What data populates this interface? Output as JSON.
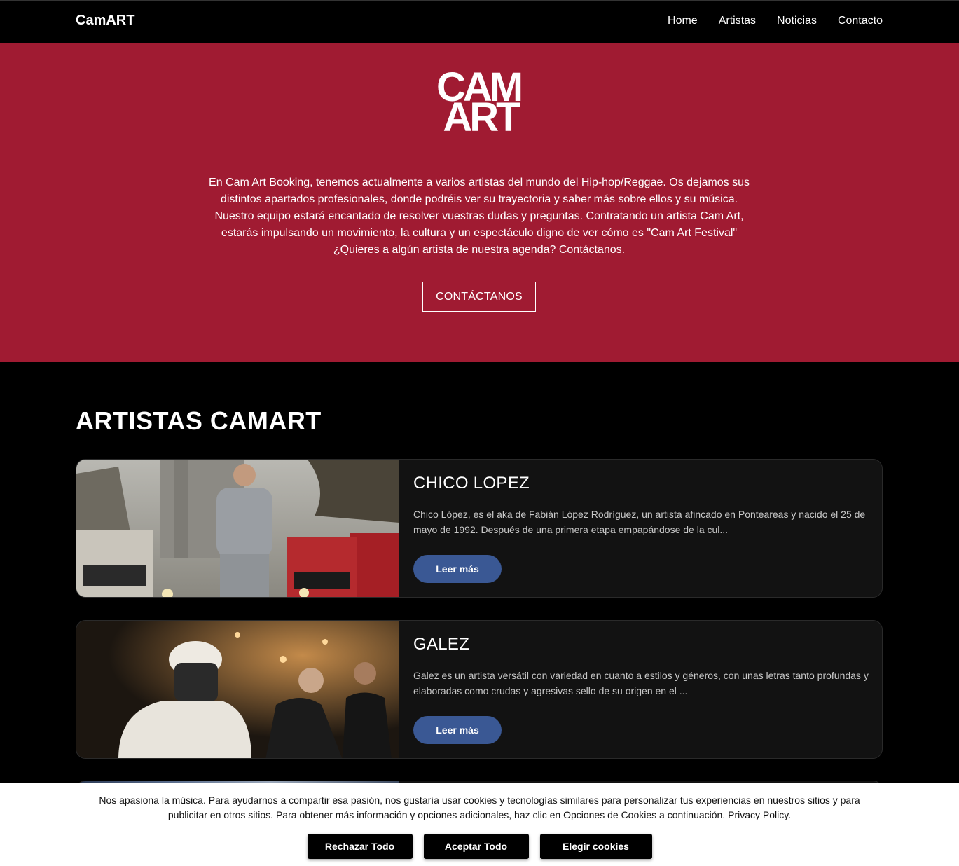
{
  "nav": {
    "brand": "CamART",
    "links": [
      "Home",
      "Artistas",
      "Noticias",
      "Contacto"
    ]
  },
  "hero": {
    "logo_line1": "CAM",
    "logo_line2": "ART",
    "lines": [
      "En Cam Art Booking, tenemos actualmente a varios artistas del mundo del Hip-hop/Reggae. Os dejamos sus",
      "distintos apartados profesionales, donde podréis ver su trayectoria y saber más sobre ellos y su música.",
      "Nuestro equipo estará encantado de resolver vuestras dudas y preguntas. Contratando un artista Cam Art,",
      "estarás impulsando un movimiento, la cultura y un espectáculo digno de ver cómo es \"Cam Art Festival\"",
      "¿Quieres a algún artista de nuestra agenda? Contáctanos."
    ],
    "button": "CONTÁCTANOS"
  },
  "artists": {
    "title": "ARTISTAS CAMART",
    "items": [
      {
        "name": "CHICO LOPEZ",
        "text": "Chico López, es el aka de Fabián López Rodríguez, un artista afincado en Ponteareas y nacido el 25 de mayo de 1992. Después de una primera etapa empapándose de la cul...",
        "button": "Leer más",
        "image_icon": "artist-photo-chico-lopez"
      },
      {
        "name": "GALEZ",
        "text": "Galez es un artista versátil con variedad en cuanto a estilos y géneros, con unas letras tanto profundas y elaboradas como crudas y agresivas sello de su origen en el ...",
        "button": "Leer más",
        "image_icon": "artist-photo-galez"
      }
    ]
  },
  "cookies": {
    "text": "Nos apasiona la música. Para ayudarnos a compartir esa pasión, nos gustaría usar cookies y tecnologías similares para personalizar tus experiencias en nuestros sitios y para publicitar en otros sitios. Para obtener más información y opciones adicionales, haz clic en Opciones de Cookies a continuación. Privacy Policy.",
    "reject": "Rechazar Todo",
    "accept": "Aceptar Todo",
    "choose": "Elegir cookies"
  },
  "colors": {
    "hero_bg": "#a01b32",
    "button_blue": "#3a5894",
    "card_bg": "#121212"
  }
}
